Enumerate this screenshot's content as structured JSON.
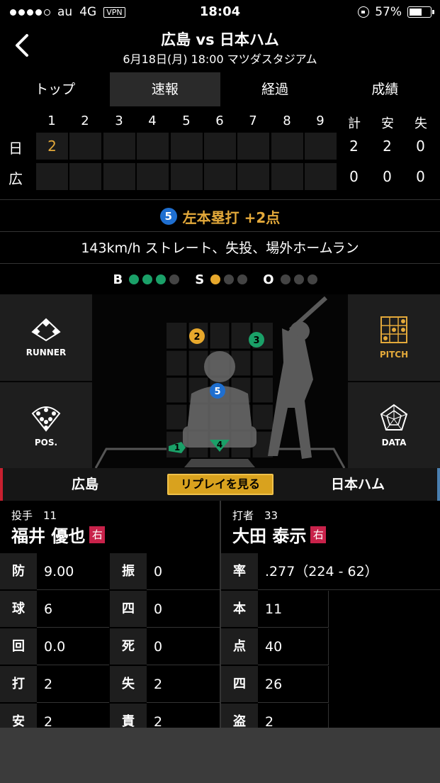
{
  "status": {
    "carrier": "au",
    "network": "4G",
    "vpn": "VPN",
    "time": "18:04",
    "battery": "57%"
  },
  "header": {
    "title": "広島 vs 日本ハム",
    "subtitle": "6月18日(月) 18:00 マツダスタジアム"
  },
  "tabs": [
    {
      "label": "トップ",
      "active": false
    },
    {
      "label": "速報",
      "active": true
    },
    {
      "label": "経過",
      "active": false
    },
    {
      "label": "成績",
      "active": false
    }
  ],
  "scoreboard": {
    "headers": [
      "1",
      "2",
      "3",
      "4",
      "5",
      "6",
      "7",
      "8",
      "9",
      "計",
      "安",
      "失"
    ],
    "rows": [
      {
        "team": "日",
        "innings": [
          "2",
          "",
          "",
          "",
          "",
          "",
          "",
          "",
          ""
        ],
        "totals": [
          "2",
          "2",
          "0"
        ]
      },
      {
        "team": "広",
        "innings": [
          "",
          "",
          "",
          "",
          "",
          "",
          "",
          "",
          ""
        ],
        "totals": [
          "0",
          "0",
          "0"
        ]
      }
    ]
  },
  "play": {
    "number": "5",
    "result": "左本塁打 +2点",
    "description": "143km/h ストレート、失投、場外ホームラン"
  },
  "count": {
    "b_label": "B",
    "s_label": "S",
    "o_label": "O",
    "balls": 3,
    "strikes": 1,
    "outs": 0
  },
  "field": {
    "runner_label": "RUNNER",
    "pitch_label": "PITCH",
    "pos_label": "POS.",
    "data_label": "DATA",
    "pitches": [
      {
        "n": "1",
        "color": "#1aa068"
      },
      {
        "n": "2",
        "color": "#e7a82c"
      },
      {
        "n": "3",
        "color": "#1aa068"
      },
      {
        "n": "4",
        "color": "#1aa068"
      },
      {
        "n": "5",
        "color": "#1f6fd0"
      }
    ]
  },
  "teambar": {
    "home": "広島",
    "replay": "リプレイを見る",
    "away": "日本ハム"
  },
  "pitcher": {
    "role": "投手　11",
    "name": "福井 優也",
    "hand": "右",
    "stats": [
      {
        "k": "防",
        "v": "9.00"
      },
      {
        "k": "振",
        "v": "0"
      },
      {
        "k": "球",
        "v": "6"
      },
      {
        "k": "四",
        "v": "0"
      },
      {
        "k": "回",
        "v": "0.0"
      },
      {
        "k": "死",
        "v": "0"
      },
      {
        "k": "打",
        "v": "2"
      },
      {
        "k": "失",
        "v": "2"
      },
      {
        "k": "安",
        "v": "2"
      },
      {
        "k": "責",
        "v": "2"
      }
    ]
  },
  "batter": {
    "role": "打者　33",
    "name": "大田 泰示",
    "hand": "右",
    "avg_key": "率",
    "avg_val": ".277（224 - 62）",
    "stats": [
      {
        "k": "本",
        "v": "11"
      },
      {
        "k": "点",
        "v": "40"
      },
      {
        "k": "四",
        "v": "26"
      },
      {
        "k": "盗",
        "v": "2"
      }
    ]
  }
}
